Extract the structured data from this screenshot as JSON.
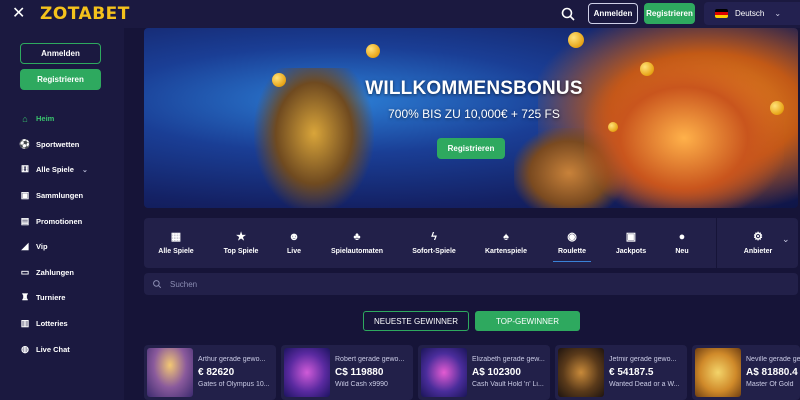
{
  "brand": {
    "logo_text": "ZOTABET"
  },
  "header": {
    "login_label": "Anmelden",
    "register_label": "Registrieren",
    "language": "Deutsch"
  },
  "sidebar": {
    "login_label": "Anmelden",
    "register_label": "Registrieren",
    "items": [
      {
        "label": "Heim",
        "icon": "home-icon",
        "active": true
      },
      {
        "label": "Sportwetten",
        "icon": "football-icon"
      },
      {
        "label": "Alle Spiele",
        "icon": "dice-icon",
        "has_caret": true
      },
      {
        "label": "Sammlungen",
        "icon": "collection-icon"
      },
      {
        "label": "Promotionen",
        "icon": "gift-icon"
      },
      {
        "label": "Vip",
        "icon": "vip-icon"
      },
      {
        "label": "Zahlungen",
        "icon": "wallet-icon"
      },
      {
        "label": "Turniere",
        "icon": "trophy-icon"
      },
      {
        "label": "Lotteries",
        "icon": "ticket-icon"
      },
      {
        "label": "Live Chat",
        "icon": "chat-icon"
      }
    ]
  },
  "banner": {
    "title": "WILLKOMMENSBONUS",
    "subtitle": "700% BIS ZU 10,000€ + 725 FS",
    "cta_label": "Registrieren"
  },
  "categories": [
    {
      "label": "Alle Spiele",
      "icon": "grid-icon"
    },
    {
      "label": "Top Spiele",
      "icon": "star-icon"
    },
    {
      "label": "Live",
      "icon": "live-dealer-icon"
    },
    {
      "label": "Spielautomaten",
      "icon": "cherry-icon"
    },
    {
      "label": "Sofort-Spiele",
      "icon": "lightning-icon"
    },
    {
      "label": "Kartenspiele",
      "icon": "cards-icon"
    },
    {
      "label": "Roulette",
      "icon": "roulette-icon",
      "active": true
    },
    {
      "label": "Jackpots",
      "icon": "jackpot-icon"
    },
    {
      "label": "Neu",
      "icon": "new-icon"
    },
    {
      "label": "Anbieter",
      "icon": "provider-icon"
    }
  ],
  "search": {
    "placeholder": "Suchen"
  },
  "winners_toggle": {
    "newest_label": "NEUESTE GEWINNER",
    "top_label": "TOP-GEWINNER"
  },
  "winners": [
    {
      "who": "Arthur gerade gewo...",
      "amount": "€ 82620",
      "game": "Gates of Olympus 10..."
    },
    {
      "who": "Robert gerade gewo...",
      "amount": "C$ 119880",
      "game": "Wild Cash x9990"
    },
    {
      "who": "Elizabeth gerade gew...",
      "amount": "A$ 102300",
      "game": "Cash Vault Hold 'n' Li..."
    },
    {
      "who": "Jetmir gerade gewo...",
      "amount": "€ 54187.5",
      "game": "Wanted Dead or a W..."
    },
    {
      "who": "Neville gerade ge...",
      "amount": "A$ 81880.4",
      "game": "Master Of Gold"
    }
  ],
  "colors": {
    "background": "#161438",
    "panel": "#222049",
    "accent_green": "#2ea95f",
    "logo_yellow": "#f4c21c"
  }
}
